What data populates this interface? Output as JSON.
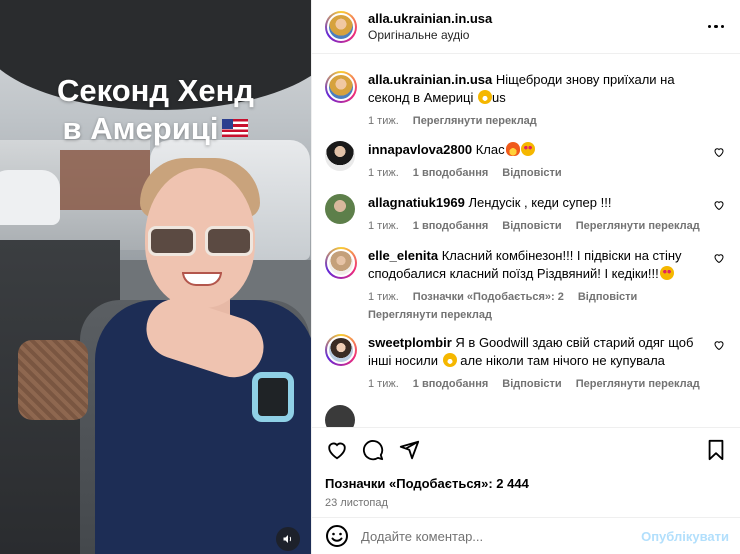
{
  "media": {
    "overlay_line1": "Секонд Хенд",
    "overlay_line2": "в Америці",
    "audio_icon": "speaker-icon"
  },
  "header": {
    "username": "alla.ukrainian.in.usa",
    "audio": "Оригінальне аудіо"
  },
  "caption": {
    "username": "alla.ukrainian.in.usa",
    "text": "Ніщеброди знову приїхали на секонд в Америці",
    "suffix": "us",
    "time": "1 тиж.",
    "translate": "Переглянути переклад"
  },
  "comments": [
    {
      "username": "innapavlova2800",
      "text": "Клас",
      "time": "1 тиж.",
      "likes": "1 вподобання",
      "reply": "Відповісти",
      "translate": ""
    },
    {
      "username": "allagnatiuk1969",
      "text": "Лендусік , кеди супер !!!",
      "time": "1 тиж.",
      "likes": "1 вподобання",
      "reply": "Відповісти",
      "translate": "Переглянути переклад"
    },
    {
      "username": "elle_elenita",
      "text": "Класний комбінезон!!! І підвіски на стіну сподобалися класний поїзд Різдвяний! І кедіки!!!",
      "time": "1 тиж.",
      "likes": "Позначки «Подобається»: 2",
      "reply": "Відповісти",
      "translate": "Переглянути переклад"
    },
    {
      "username": "sweetplombir",
      "text": "Я в Goodwill здаю свій старий одяг щоб інші носили",
      "text2": "але ніколи там нічого не купувала",
      "time": "1 тиж.",
      "likes": "1 вподобання",
      "reply": "Відповісти",
      "translate": "Переглянути переклад"
    }
  ],
  "actions": {
    "likes_text": "Позначки «Подобається»: 2 444",
    "date": "23 листопад"
  },
  "add_comment": {
    "placeholder": "Додайте коментар...",
    "publish": "Опублікувати"
  }
}
